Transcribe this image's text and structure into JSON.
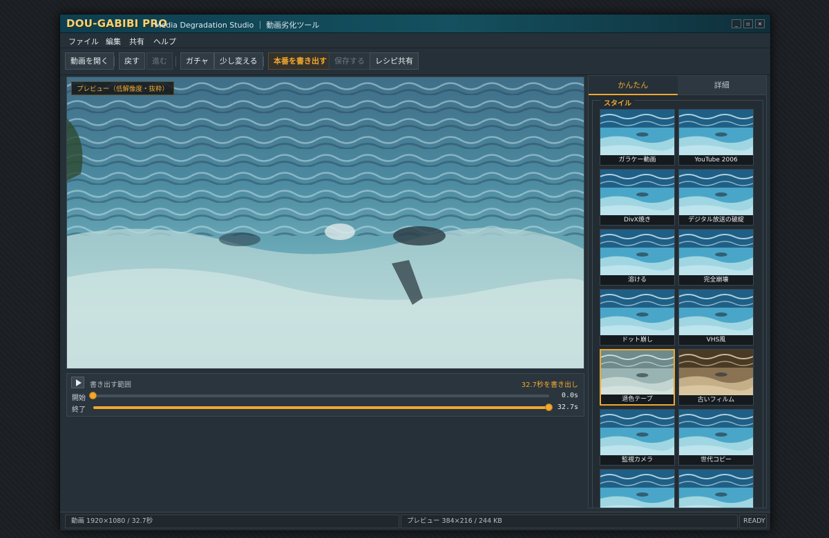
{
  "window": {
    "logo": "DOU-GABIBI PRO",
    "subtitle": "Media Degradation Studio ｜ 動画劣化ツール",
    "controls": [
      "_",
      "▫",
      "×"
    ]
  },
  "menu": [
    "ファイル",
    "編集",
    "共有",
    "ヘルプ"
  ],
  "toolbar": {
    "open": "動画を開く",
    "undo": "戻す",
    "redo": "進む",
    "gacha": "ガチャ",
    "tweak": "少し変える",
    "export": "本番を書き出す",
    "save": "保存する",
    "share": "レシピ共有"
  },
  "preview": {
    "badge": "プレビュー（低解像度・抜粋）"
  },
  "range": {
    "title": "書き出す範囲",
    "summary": "32.7秒を書き出し",
    "start_label": "開始",
    "start_value": "0.0s",
    "end_label": "終了",
    "end_value": "32.7s",
    "start_fraction": 0.0,
    "end_fraction": 1.0
  },
  "side": {
    "tab_simple": "かんたん",
    "tab_detail": "詳細",
    "styles_legend": "スタイル",
    "styles": [
      {
        "label": "ガラケー動画",
        "selected": false,
        "tone": "blue"
      },
      {
        "label": "YouTube 2006",
        "selected": false,
        "tone": "blue"
      },
      {
        "label": "DivX焼き",
        "selected": false,
        "tone": "blue"
      },
      {
        "label": "デジタル放送の破綻",
        "selected": false,
        "tone": "blue"
      },
      {
        "label": "溶ける",
        "selected": false,
        "tone": "blue"
      },
      {
        "label": "完全崩壊",
        "selected": false,
        "tone": "blue"
      },
      {
        "label": "ドット崩し",
        "selected": false,
        "tone": "blue"
      },
      {
        "label": "VHS風",
        "selected": false,
        "tone": "blue"
      },
      {
        "label": "退色テープ",
        "selected": true,
        "tone": "faded"
      },
      {
        "label": "古いフィルム",
        "selected": false,
        "tone": "sepia"
      },
      {
        "label": "監視カメラ",
        "selected": false,
        "tone": "blue"
      },
      {
        "label": "世代コピー",
        "selected": false,
        "tone": "blue"
      },
      {
        "label": "",
        "selected": false,
        "tone": "blue"
      },
      {
        "label": "",
        "selected": false,
        "tone": "blue"
      }
    ]
  },
  "status": {
    "video": "動画 1920×1080 / 32.7秒",
    "preview": "プレビュー 384×216 / 244 KB",
    "state": "READY"
  }
}
